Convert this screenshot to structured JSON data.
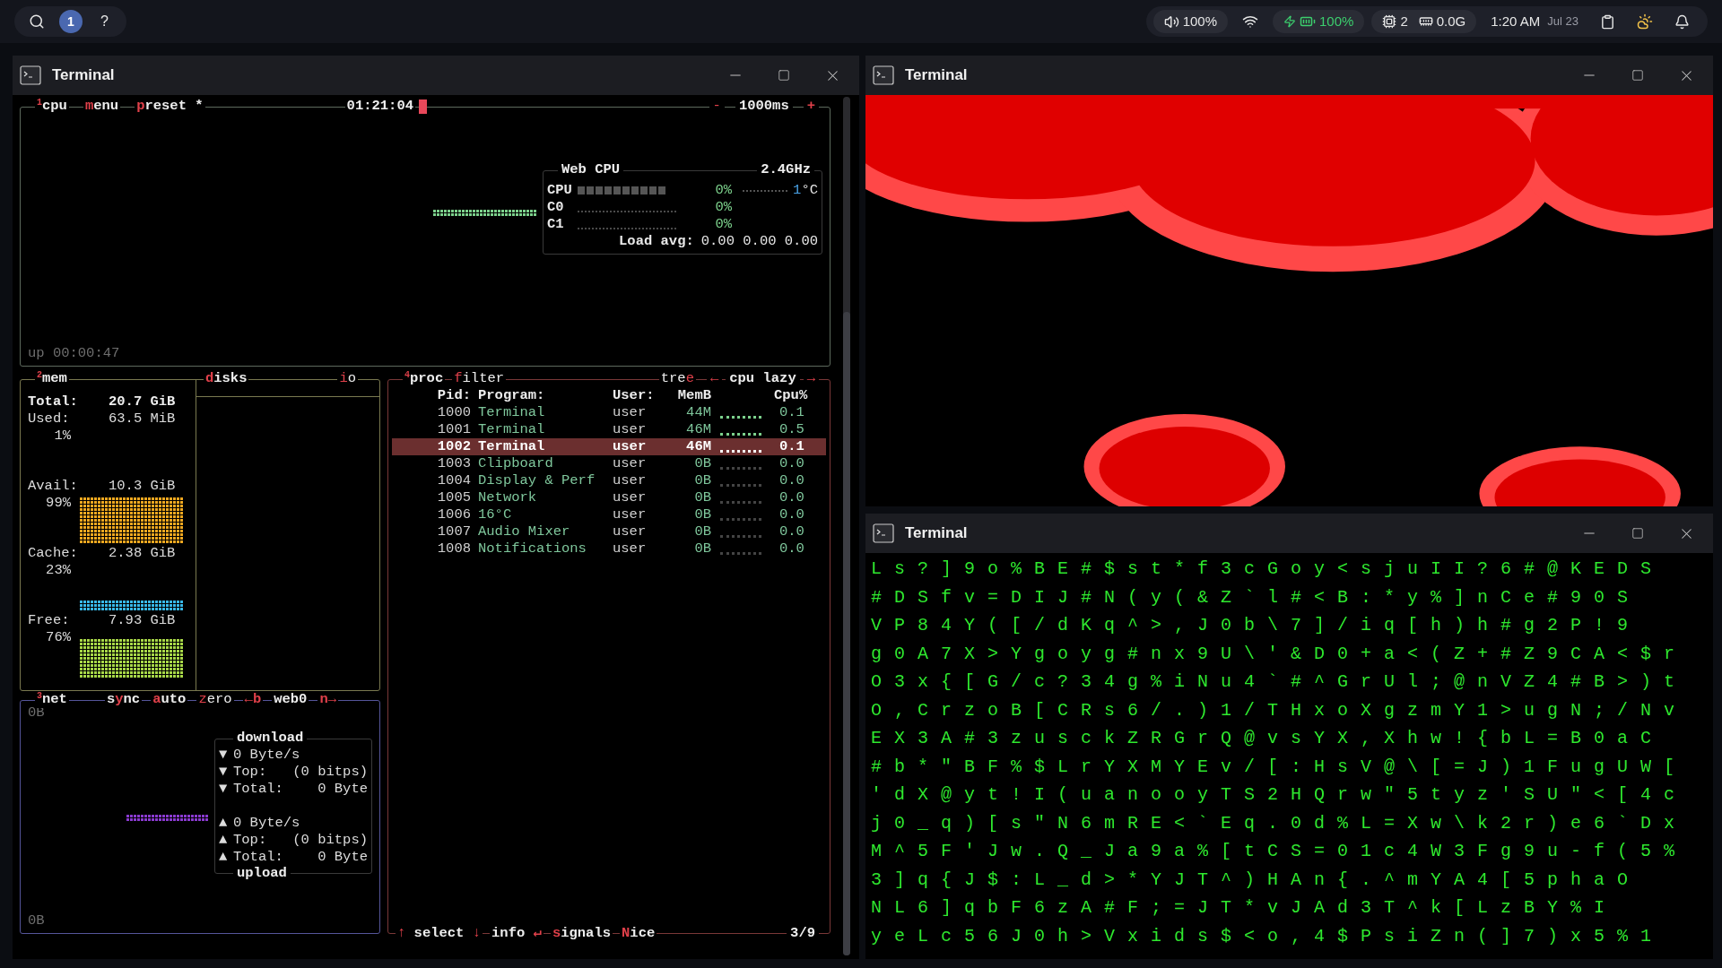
{
  "top_bar": {
    "workspace": "1",
    "help": "?",
    "volume": "100%",
    "battery": "100%",
    "cpu_cores": "2",
    "memory": "0.0G",
    "time": "1:20 AM",
    "date": "Jul 23"
  },
  "windows": [
    {
      "title": "Terminal",
      "kind": "btop"
    },
    {
      "title": "Terminal",
      "kind": "picture"
    },
    {
      "title": "Terminal",
      "kind": "matrix"
    }
  ],
  "btop": {
    "cpu": {
      "number": "1",
      "title": "cpu",
      "tabs": [
        {
          "segments": [
            {
              "text": "m",
              "hot": true
            },
            {
              "text": "enu",
              "hot": false
            }
          ]
        },
        {
          "segments": [
            {
              "text": "p",
              "hot": true
            },
            {
              "text": "reset *",
              "hot": false
            }
          ]
        }
      ],
      "clock": "01:21:04",
      "minus": "-",
      "interval": "1000ms",
      "plus": "+",
      "uptime": "up 00:00:47",
      "panel": {
        "title": "Web CPU",
        "freq": "2.4GHz",
        "rows": [
          {
            "label": "CPU",
            "value": "0%",
            "kind": "total"
          },
          {
            "label": "C0",
            "value": "0%",
            "kind": "core"
          },
          {
            "label": "C1",
            "value": "0%",
            "kind": "core"
          }
        ],
        "temp": "1",
        "temp_unit": "°C",
        "load_label": "Load avg:",
        "load": "0.00 0.00 0.00"
      }
    },
    "mem": {
      "number": "2",
      "title": "mem",
      "rows": [
        {
          "label": "Total:",
          "value": "20.7 GiB",
          "kind": "total"
        },
        {
          "label": "Used:",
          "value": "63.5 MiB",
          "percent": "1%",
          "kind": "stat"
        },
        {
          "label": "Avail:",
          "value": "10.3 GiB",
          "percent": "99%",
          "color": "#f0a820",
          "kind": "stat"
        },
        {
          "label": "Cache:",
          "value": "2.38 GiB",
          "percent": "23%",
          "color": "#38b8e8",
          "kind": "stat"
        },
        {
          "label": "Free:",
          "value": "7.93 GiB",
          "percent": "76%",
          "color": "#a8d848",
          "kind": "stat"
        }
      ],
      "disks": {
        "segments": [
          {
            "text": "d",
            "hot": true
          },
          {
            "text": "isks",
            "hot": false
          }
        ]
      },
      "io": {
        "segments": [
          {
            "text": "i",
            "hot": true
          },
          {
            "text": "o",
            "hot": false
          }
        ]
      }
    },
    "net": {
      "number": "3",
      "title": "net",
      "tabs": [
        {
          "segments": [
            {
              "text": "s",
              "hot": false
            },
            {
              "text": "y",
              "hot": true
            },
            {
              "text": "nc",
              "hot": false
            }
          ]
        },
        {
          "segments": [
            {
              "text": "a",
              "hot": true
            },
            {
              "text": "uto",
              "hot": false
            }
          ]
        },
        {
          "segments": [
            {
              "text": "z",
              "hot": true
            },
            {
              "text": "ero",
              "hot": false
            }
          ]
        },
        {
          "segments": [
            {
              "text": "←b",
              "hot": true
            }
          ]
        },
        {
          "segments": [
            {
              "text": "web0",
              "hot": false
            }
          ]
        },
        {
          "segments": [
            {
              "text": "n→",
              "hot": true
            }
          ]
        }
      ],
      "scale_top": "0B",
      "scale_bottom": "0B",
      "download": {
        "title": "download",
        "rows": [
          {
            "arrow": "▼",
            "label": "0 Byte/s"
          },
          {
            "arrow": "▼",
            "label": "Top:",
            "value": "(0 bitps)"
          },
          {
            "arrow": "▼",
            "label": "Total:",
            "value": "0 Byte"
          }
        ]
      },
      "upload": {
        "title": "upload",
        "rows": [
          {
            "arrow": "▲",
            "label": "0 Byte/s"
          },
          {
            "arrow": "▲",
            "label": "Top:",
            "value": "(0 bitps)"
          },
          {
            "arrow": "▲",
            "label": "Total:",
            "value": "0 Byte"
          }
        ]
      }
    },
    "proc": {
      "number": "4",
      "title": "proc",
      "filter": {
        "segments": [
          {
            "text": "f",
            "hot": true
          },
          {
            "text": "ilter",
            "hot": false
          }
        ]
      },
      "tree": {
        "segments": [
          {
            "text": "tre",
            "hot": false
          },
          {
            "text": "e",
            "hot": true
          }
        ]
      },
      "sort": {
        "prev": "←",
        "label": "cpu lazy",
        "next": "→"
      },
      "columns": [
        "Pid:",
        "Program:",
        "User:",
        "MemB",
        "Cpu%"
      ],
      "rows": [
        {
          "pid": "1000",
          "program": "Terminal",
          "user": "user",
          "mem": "44M",
          "cpu": "0.1",
          "active": true,
          "selected": false
        },
        {
          "pid": "1001",
          "program": "Terminal",
          "user": "user",
          "mem": "46M",
          "cpu": "0.5",
          "active": true,
          "selected": false
        },
        {
          "pid": "1002",
          "program": "Terminal",
          "user": "user",
          "mem": "46M",
          "cpu": "0.1",
          "active": true,
          "selected": true
        },
        {
          "pid": "1003",
          "program": "Clipboard",
          "user": "user",
          "mem": "0B",
          "cpu": "0.0",
          "active": false,
          "selected": false
        },
        {
          "pid": "1004",
          "program": "Display & Perf",
          "user": "user",
          "mem": "0B",
          "cpu": "0.0",
          "active": false,
          "selected": false
        },
        {
          "pid": "1005",
          "program": "Network",
          "user": "user",
          "mem": "0B",
          "cpu": "0.0",
          "active": false,
          "selected": false
        },
        {
          "pid": "1006",
          "program": "16°C",
          "user": "user",
          "mem": "0B",
          "cpu": "0.0",
          "active": false,
          "selected": false
        },
        {
          "pid": "1007",
          "program": "Audio Mixer",
          "user": "user",
          "mem": "0B",
          "cpu": "0.0",
          "active": false,
          "selected": false
        },
        {
          "pid": "1008",
          "program": "Notifications",
          "user": "user",
          "mem": "0B",
          "cpu": "0.0",
          "active": false,
          "selected": false
        }
      ],
      "footer": [
        {
          "segments": [
            {
              "text": "↑",
              "hot": true
            },
            {
              "text": " select ",
              "hot": false
            },
            {
              "text": "↓",
              "hot": true
            }
          ]
        },
        {
          "segments": [
            {
              "text": "info",
              "hot": false
            },
            {
              "text": " ↵",
              "hot": true
            }
          ]
        },
        {
          "segments": [
            {
              "text": "s",
              "hot": true
            },
            {
              "text": "ignals",
              "hot": false
            }
          ]
        },
        {
          "segments": [
            {
              "text": "N",
              "hot": true
            },
            {
              "text": "ice",
              "hot": false
            }
          ]
        }
      ],
      "count": "3/9"
    }
  },
  "matrix": {
    "rows": [
      "Ls?]9o%BE#$st*f3cGoy<sjuII?6#@KEDS",
      "#DSfv=DIJ#N(y(&Z`l#<B:*y%]nCe#90S",
      "VP84Y([/dKq^>,J0b\\7]/iq[h)h#g2P!9",
      "g0A7X>Ygoyg#nx9U\\'&D0+a<(Z+#Z9CA<$r",
      "O3x{[G/c?34g%iNu4`#^GrUl;@nVZ4#B>)t",
      "O,CrzoB[CRs6/.)1/THxoXgzmY1>ugN;/Nv",
      "EX3A#3zusckZRGrQ@vsYX,Xhw!{bL=B0aC",
      "#b*\"BF%$LrYXMYEv/[:HsV@\\[=J)1FugUW[",
      "'dX@yt!I(uanooyTS2HQrw\"5tyz'SU\"<[4c",
      "j0_q)[s\"N6mRE<`Eq.0d%L=Xw\\k2r)e6`Dx",
      "M^5F'Jw.Q_Ja9a%[tCS=01c4W3Fg9u-f(5%",
      "3]q{J$:L_d>*YJT^)HAn{.^mYA4[5phaO",
      "NL6]qbF6zA#F;=JT*vJAd3T^k[LzBY%I",
      "yeLc56J0h>Vxids$<o,4$PsiZn(]7)x5%1"
    ]
  }
}
